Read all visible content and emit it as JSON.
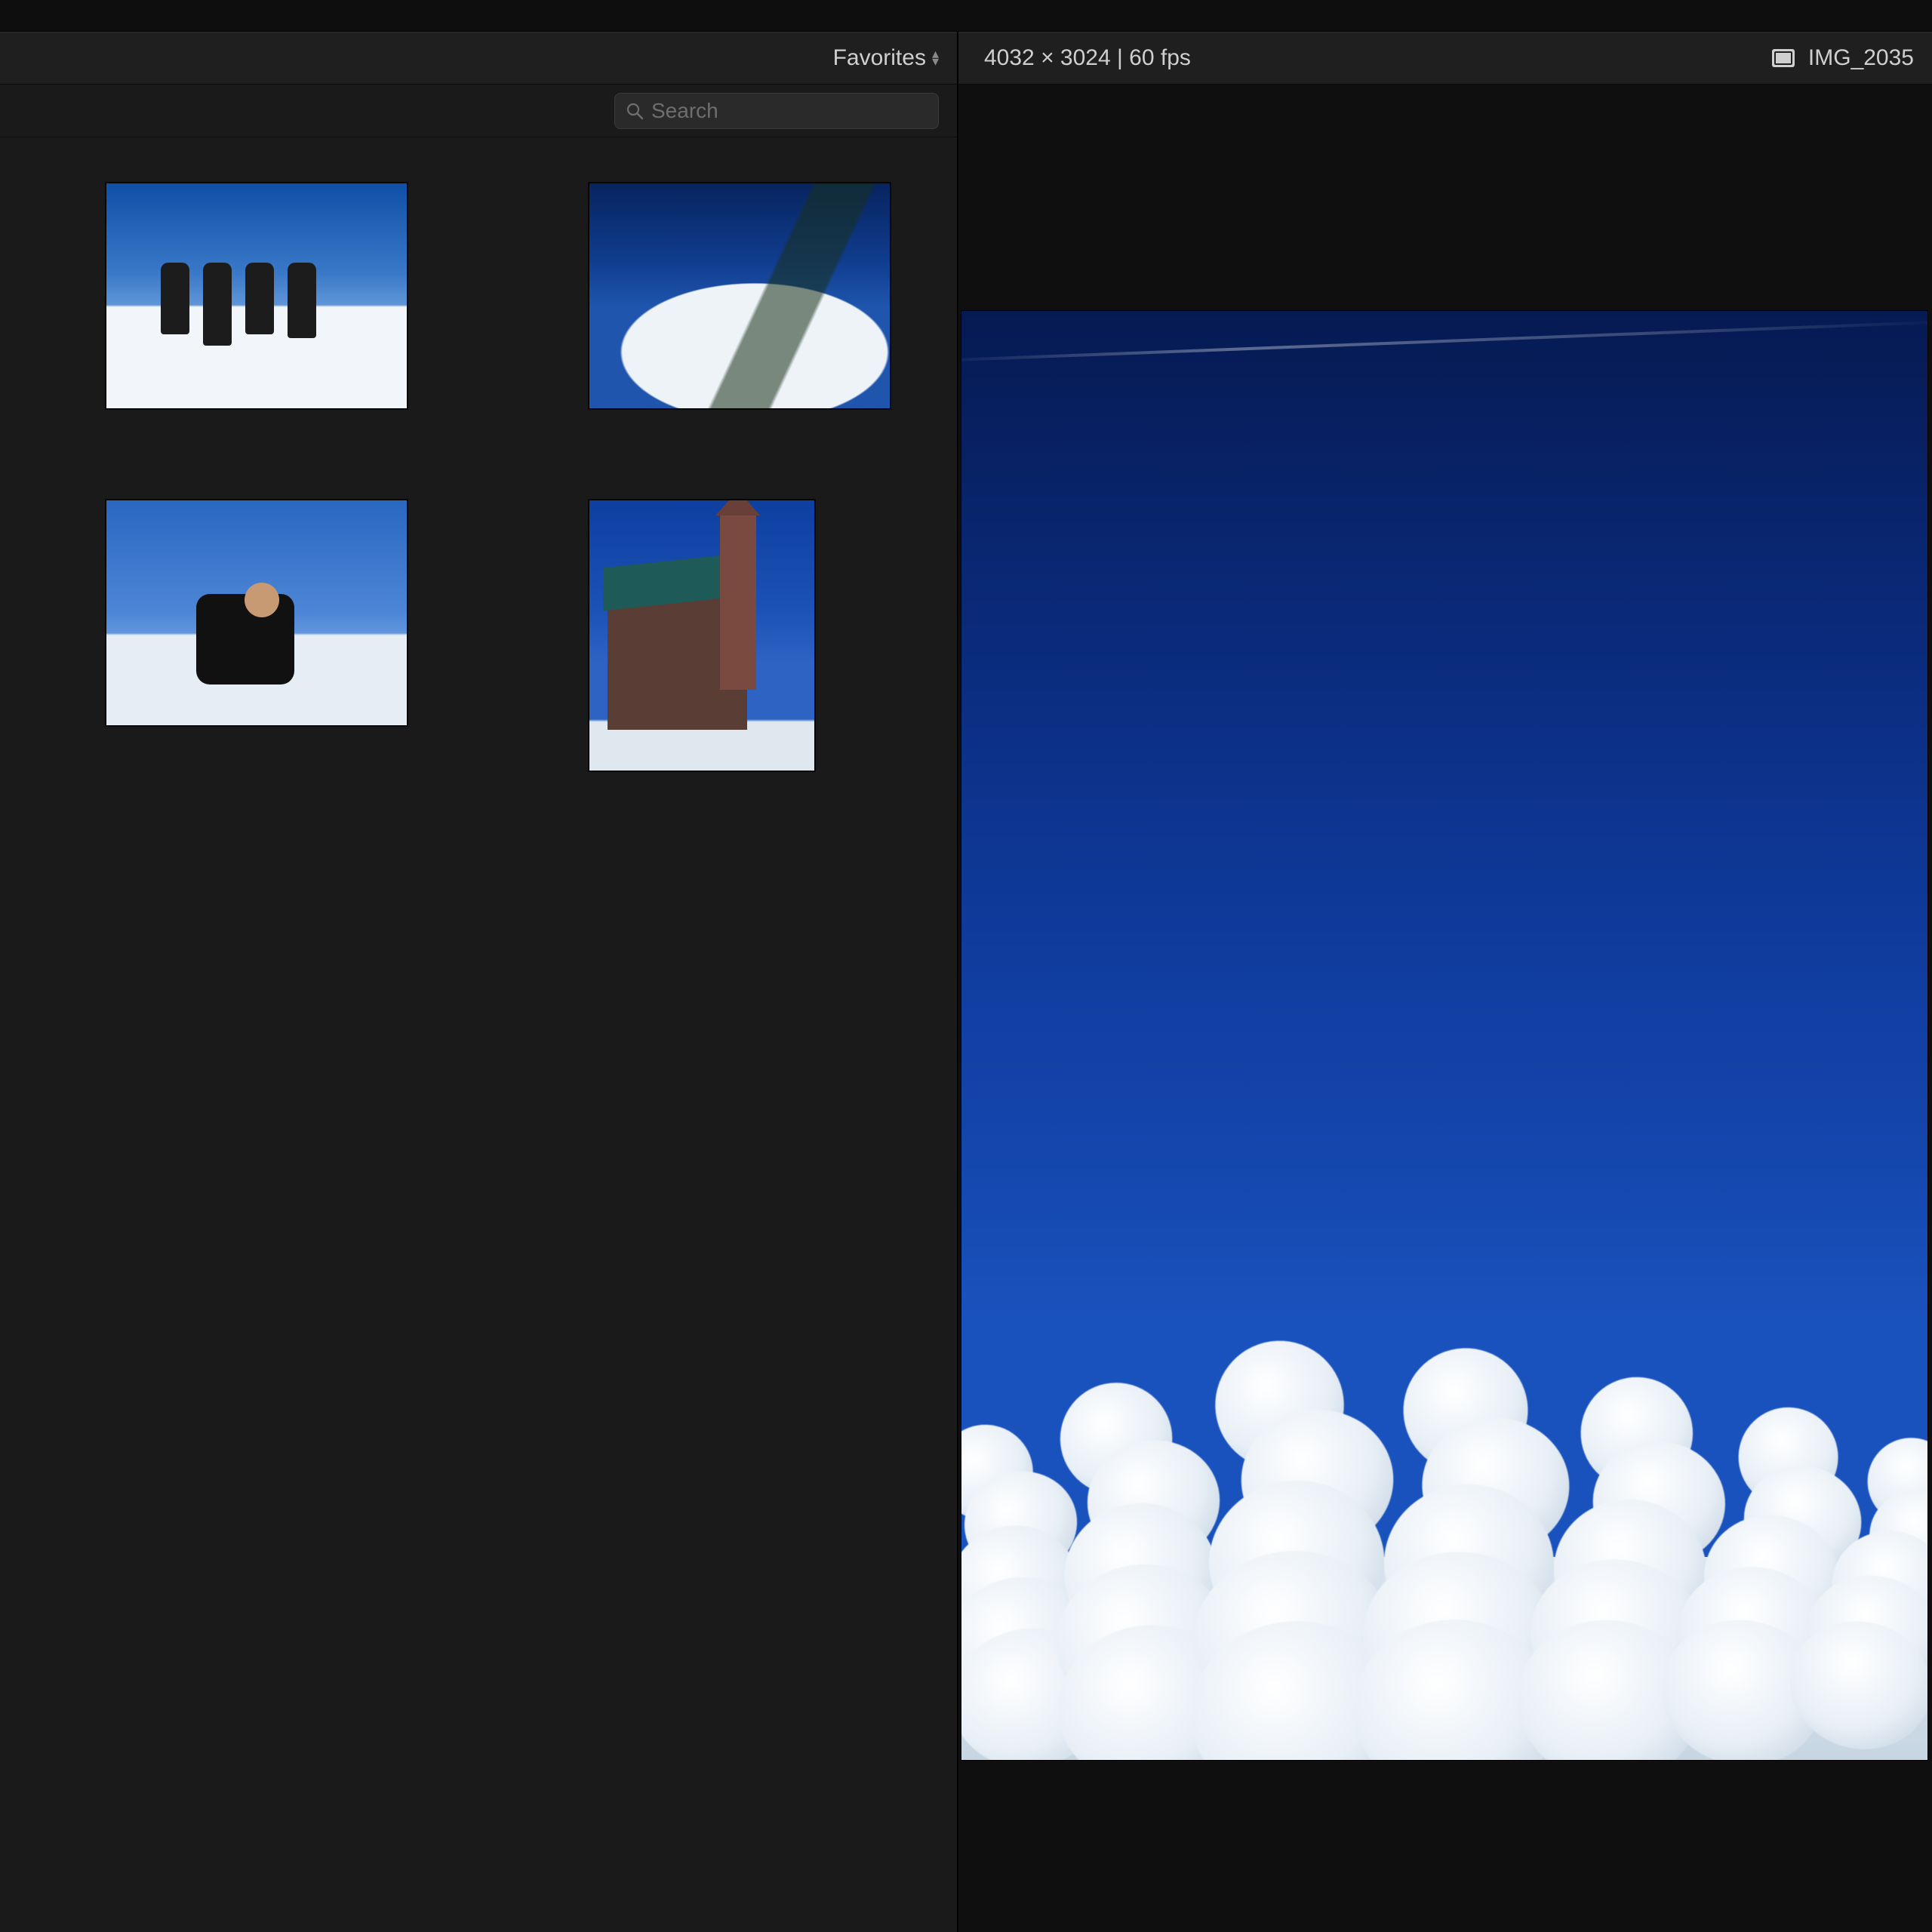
{
  "browser": {
    "filter_label": "Favorites",
    "search_placeholder": "Search",
    "thumbnails": [
      {
        "name": "thumb-group-ski"
      },
      {
        "name": "thumb-snowy-mountain"
      },
      {
        "name": "thumb-sitting-snow"
      },
      {
        "name": "thumb-church-building"
      }
    ]
  },
  "viewer": {
    "dimensions": "4032 × 3024",
    "fps_label": "60 fps",
    "separator": " | ",
    "clip_name": "IMG_2035"
  }
}
